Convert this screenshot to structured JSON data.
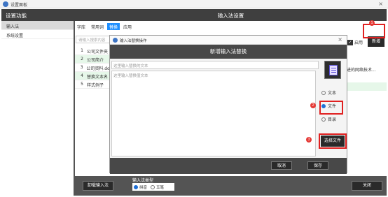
{
  "window": {
    "title": "设置面板",
    "close": "×"
  },
  "sidebar": {
    "title": "设置功能",
    "items": [
      {
        "label": "输入法"
      },
      {
        "label": "系统设置"
      }
    ]
  },
  "main": {
    "title": "输入法设置",
    "tabs": [
      {
        "label": "字库"
      },
      {
        "label": "常用词"
      },
      {
        "label": "替换"
      },
      {
        "label": "应用"
      }
    ],
    "search_placeholder": "请输入搜索内容",
    "rows": [
      {
        "num": "1",
        "text": "公司文件夹"
      },
      {
        "num": "2",
        "text": "公司简介"
      },
      {
        "num": "3",
        "text": "公司资料.doc"
      },
      {
        "num": "4",
        "text": "替换文本名"
      },
      {
        "num": "5",
        "text": "样式例子"
      }
    ],
    "peek_text": "先进的网络技术...",
    "enable_label": "启用",
    "add_button": "新增"
  },
  "footer": {
    "export_button": "卸载输入法",
    "type_label": "输入法类型",
    "options": [
      {
        "label": "拼音"
      },
      {
        "label": "五笔"
      }
    ],
    "close_button": "关闭"
  },
  "modal": {
    "window_title": "输入法替换操作",
    "heading": "新增输入法替换",
    "replace_placeholder": "这里输入替换的文本",
    "value_placeholder": "这里输入替换值文本",
    "options": [
      {
        "label": "文本"
      },
      {
        "label": "文件"
      },
      {
        "label": "目录"
      }
    ],
    "select_file": "选择文件",
    "cancel": "取消",
    "save": "保存",
    "close": "×"
  },
  "markers": [
    "1",
    "2",
    "3"
  ],
  "colors": {
    "accent": "#1f8fff",
    "highlight": "#e02020",
    "dark": "#3f3f3f"
  }
}
